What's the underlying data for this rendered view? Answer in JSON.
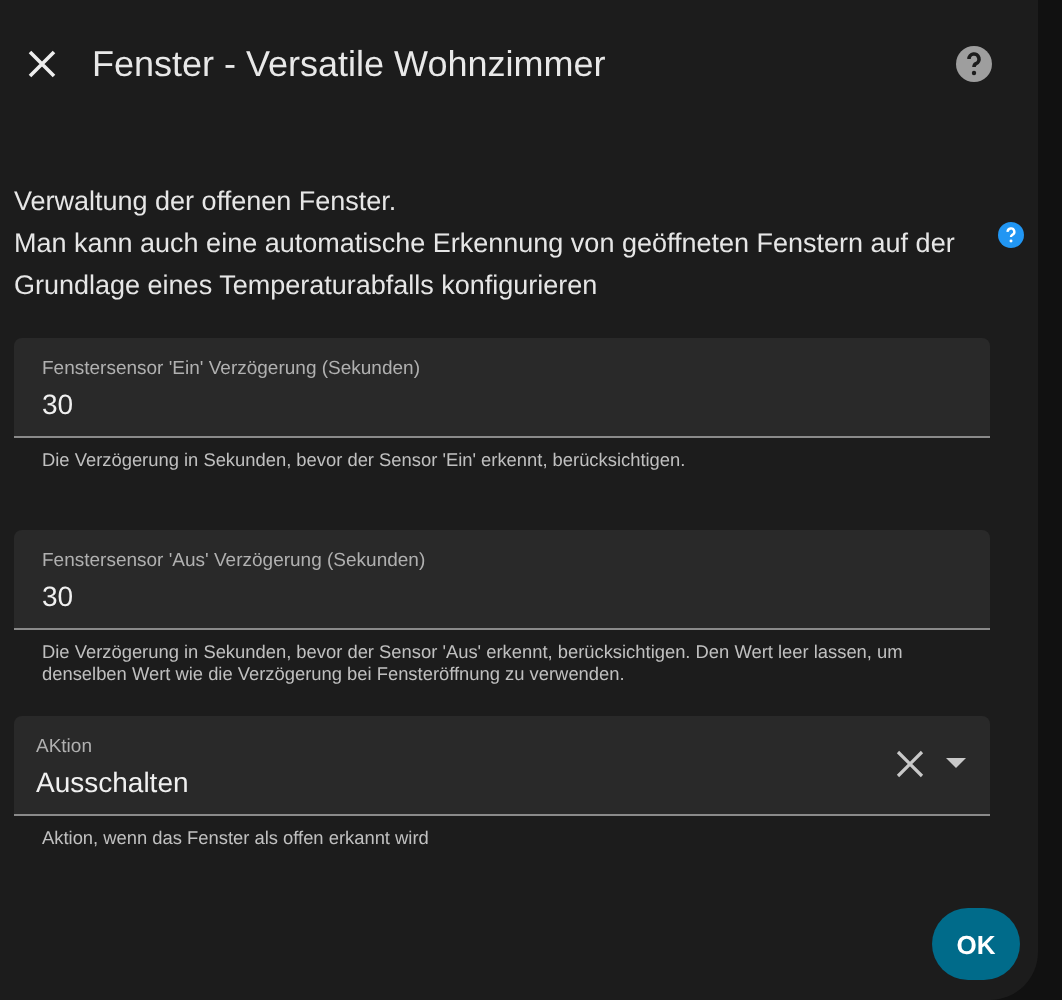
{
  "dialog": {
    "title": "Fenster - Versatile Wohnzimmer"
  },
  "description": [
    "Verwaltung der offenen Fenster.",
    "Man kann auch eine automatische Erkennung von geöffneten Fenstern auf der Grundlage eines Temperaturabfalls konfigurieren"
  ],
  "fields": [
    {
      "kind": "number",
      "label": "Fenstersensor 'Ein' Verzögerung (Sekunden)",
      "value": "30",
      "helper": "Die Verzögerung in Sekunden, bevor der Sensor 'Ein' erkennt, berücksichtigen."
    },
    {
      "kind": "number",
      "label": "Fenstersensor 'Aus' Verzögerung (Sekunden)",
      "value": "30",
      "helper": "Die Verzögerung in Sekunden, bevor der Sensor 'Aus' erkennt, berücksichtigen. Den Wert leer lassen, um denselben Wert wie die Verzögerung bei Fensteröffnung zu verwenden."
    },
    {
      "kind": "select",
      "label": "AKtion",
      "value": "Ausschalten",
      "helper": "Aktion, wenn das Fenster als offen erkannt wird"
    }
  ],
  "buttons": [
    "OK"
  ]
}
